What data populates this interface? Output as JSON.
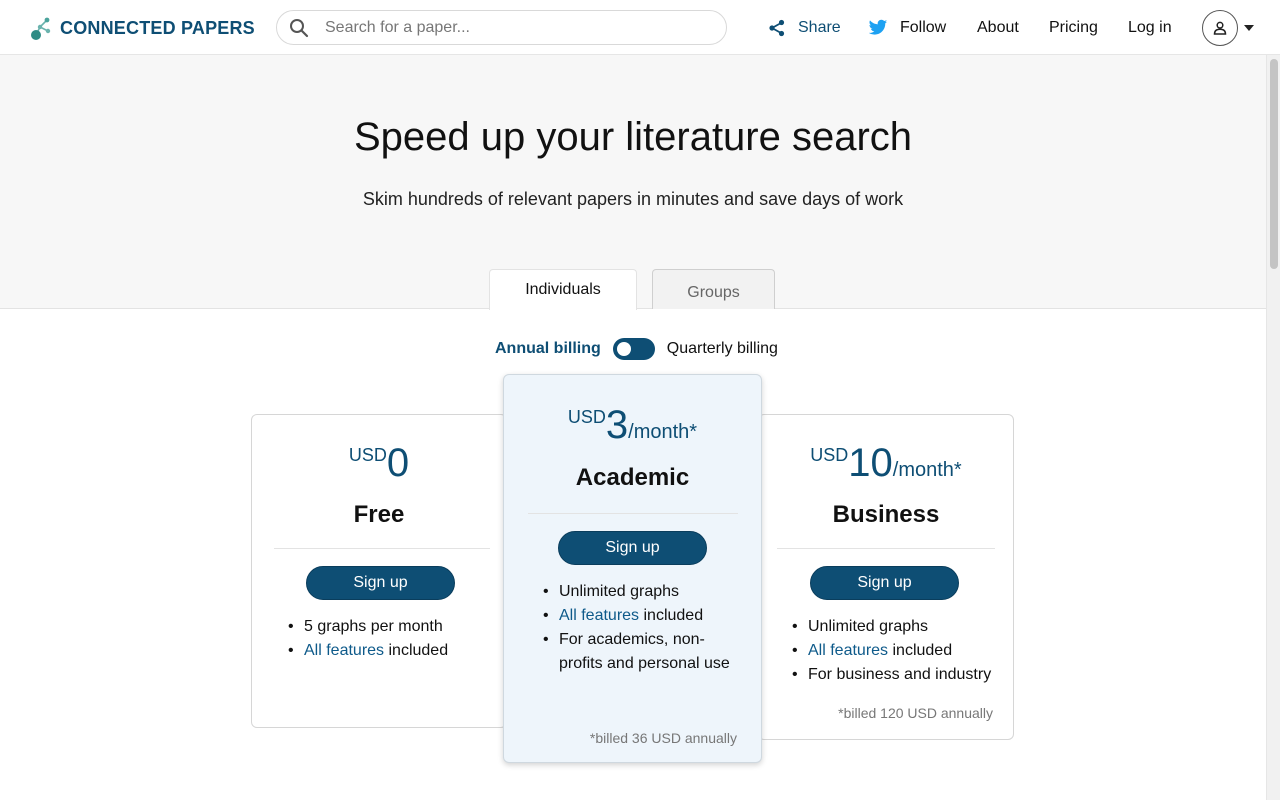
{
  "header": {
    "logo_text": "CONNECTED PAPERS",
    "search_placeholder": "Search for a paper...",
    "nav": {
      "share": "Share",
      "follow": "Follow",
      "about": "About",
      "pricing": "Pricing",
      "login": "Log in"
    }
  },
  "hero": {
    "title": "Speed up your literature search",
    "subtitle": "Skim hundreds of relevant papers in minutes and save days of work"
  },
  "tabs": {
    "individuals": "Individuals",
    "groups": "Groups",
    "active": "Individuals"
  },
  "billing": {
    "annual_label": "Annual billing",
    "quarterly_label": "Quarterly billing",
    "selected": "Annual billing"
  },
  "plans": {
    "free": {
      "currency": "USD",
      "price": "0",
      "per": "",
      "name": "Free",
      "signup_label": "Sign up",
      "features": {
        "f1": "5 graphs per month",
        "f2_link": "All features",
        "f2_rest": " included"
      },
      "billed_note": ""
    },
    "academic": {
      "currency": "USD",
      "price": "3",
      "per": "/month*",
      "name": "Academic",
      "signup_label": "Sign up",
      "features": {
        "f1": "Unlimited graphs",
        "f2_link": "All features",
        "f2_rest": " included",
        "f3": "For academics, non-profits and personal use"
      },
      "billed_note": "*billed 36 USD annually"
    },
    "business": {
      "currency": "USD",
      "price": "10",
      "per": "/month*",
      "name": "Business",
      "signup_label": "Sign up",
      "features": {
        "f1": "Unlimited graphs",
        "f2_link": "All features",
        "f2_rest": " included",
        "f3": "For business and industry"
      },
      "billed_note": "*billed 120 USD annually"
    }
  },
  "colors": {
    "brand": "#0e4e74",
    "link": "#0e5a8a",
    "hero_bg": "#f7f7f7",
    "featured_card_bg": "#eef5fb"
  },
  "icons": {
    "logo": "connected-dots-logo-icon",
    "search": "search-icon",
    "share": "share-icon",
    "follow": "twitter-bird-icon",
    "avatar": "user-icon",
    "caret": "caret-down-icon"
  }
}
